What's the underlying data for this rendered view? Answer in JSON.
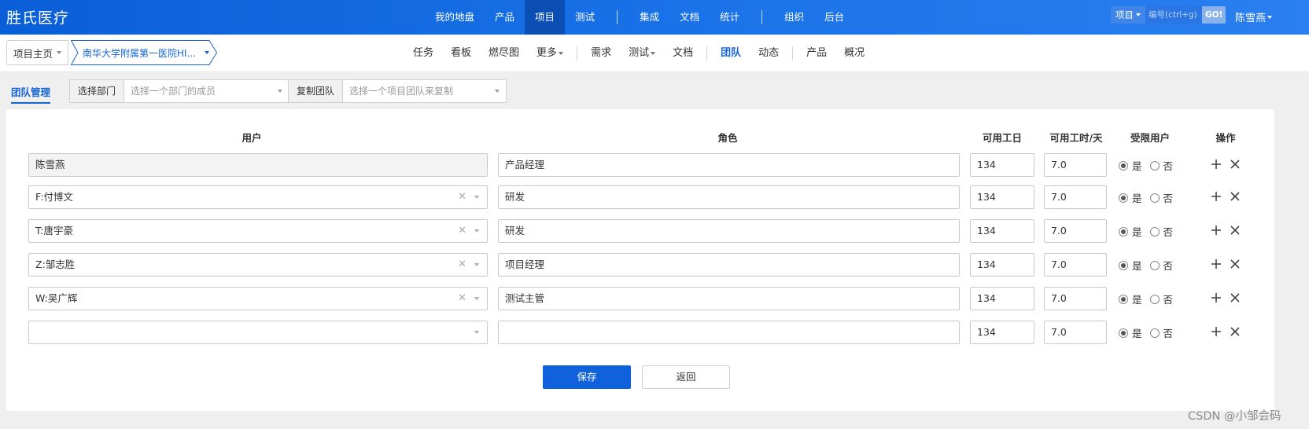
{
  "brand": "胜氏医疗",
  "main_nav": [
    {
      "label": "我的地盘"
    },
    {
      "label": "产品"
    },
    {
      "label": "项目",
      "active": true
    },
    {
      "label": "测试"
    },
    {
      "label": "集成"
    },
    {
      "label": "文档"
    },
    {
      "label": "统计"
    },
    {
      "label": "组织"
    },
    {
      "label": "后台"
    }
  ],
  "search": {
    "type": "项目",
    "placeholder": "编号(ctrl+g)",
    "go": "GO!"
  },
  "user": "陈雪燕",
  "breadcrumb": {
    "home": "项目主页",
    "project": "南华大学附属第一医院HI..."
  },
  "sub_nav": [
    {
      "label": "任务"
    },
    {
      "label": "看板"
    },
    {
      "label": "燃尽图"
    },
    {
      "label": "更多"
    },
    {
      "label": "需求"
    },
    {
      "label": "测试"
    },
    {
      "label": "文档"
    },
    {
      "label": "团队",
      "active": true
    },
    {
      "label": "动态"
    },
    {
      "label": "产品"
    },
    {
      "label": "概况"
    }
  ],
  "toolbar": {
    "team_tab": "团队管理",
    "dept_label": "选择部门",
    "dept_placeholder": "选择一个部门的成员",
    "copy_label": "复制团队",
    "copy_placeholder": "选择一个项目团队来复制"
  },
  "table": {
    "headers": {
      "user": "用户",
      "role": "角色",
      "days": "可用工日",
      "hours": "可用工时/天",
      "limited": "受限用户",
      "ops": "操作"
    },
    "radio_yes": "是",
    "radio_no": "否",
    "rows": [
      {
        "user": "陈雪燕",
        "role": "产品经理",
        "days": "134",
        "hours": "7.0",
        "limited": "yes"
      },
      {
        "user": "F:付博文",
        "role": "研发",
        "days": "134",
        "hours": "7.0",
        "limited": "yes"
      },
      {
        "user": "T:唐宇豪",
        "role": "研发",
        "days": "134",
        "hours": "7.0",
        "limited": "yes"
      },
      {
        "user": "Z:邹志胜",
        "role": "项目经理",
        "days": "134",
        "hours": "7.0",
        "limited": "yes"
      },
      {
        "user": "W:吴广辉",
        "role": "测试主管",
        "days": "134",
        "hours": "7.0",
        "limited": "yes"
      },
      {
        "user": "",
        "role": "",
        "days": "134",
        "hours": "7.0",
        "limited": "yes"
      }
    ]
  },
  "buttons": {
    "save": "保存",
    "back": "返回"
  },
  "watermark": "CSDN @小邹会码",
  "colors": {
    "primary": "#0f62dc",
    "header": "#1a73e8"
  }
}
